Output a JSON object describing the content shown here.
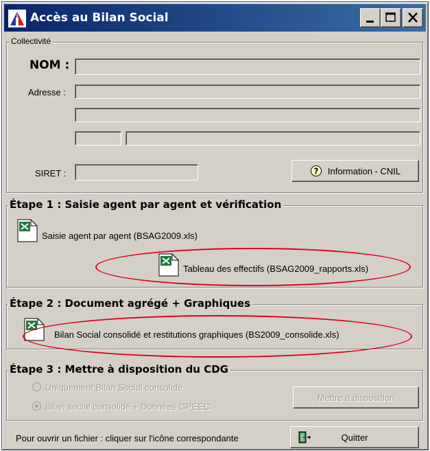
{
  "window": {
    "title": "Accès au Bilan Social",
    "controls": [
      "minimize",
      "maximize",
      "close"
    ]
  },
  "collectivite": {
    "legend": "Collectivité",
    "nom_label": "NOM :",
    "nom_value": "",
    "adresse_label": "Adresse :",
    "adresse_line1": "",
    "adresse_line2": "",
    "code_postal": "",
    "ville": "",
    "siret_label": "SIRET :",
    "siret_value": "",
    "cnil_button": "Information - CNIL"
  },
  "etape1": {
    "legend": "Étape 1 : Saisie agent par agent et vérification",
    "item1_label": "Saisie agent par agent (BSAG2009.xls)",
    "item2_label": "Tableau des effectifs (BSAG2009_rapports.xls)"
  },
  "etape2": {
    "legend": "Étape 2 : Document agrégé + Graphiques",
    "item1_label": "Bilan Social consolidé et restitutions graphiques (BS2009_consolide.xls)"
  },
  "etape3": {
    "legend": "Étape 3 : Mettre à disposition du CDG",
    "option1": "Uniquement Bilan Social consolidé",
    "option2": "Bilan social consolidé + Données GPEEC",
    "selected_option": 2,
    "publish_button": "Mettre à disposition"
  },
  "footer": {
    "hint": "Pour ouvrir un fichier : cliquer sur l'icône correspondante",
    "quit_button": "Quitter"
  },
  "colors": {
    "title_bar_start": "#0a246a",
    "title_bar_end": "#3a6ea5",
    "dialog_face": "#d4d0c8",
    "annotation_red": "#e0001a",
    "excel_green": "#1e7a3a"
  },
  "icons": {
    "app": "app-logo-icon",
    "xls": "excel-file-icon",
    "cnil": "question-icon",
    "quit": "exit-door-icon"
  }
}
